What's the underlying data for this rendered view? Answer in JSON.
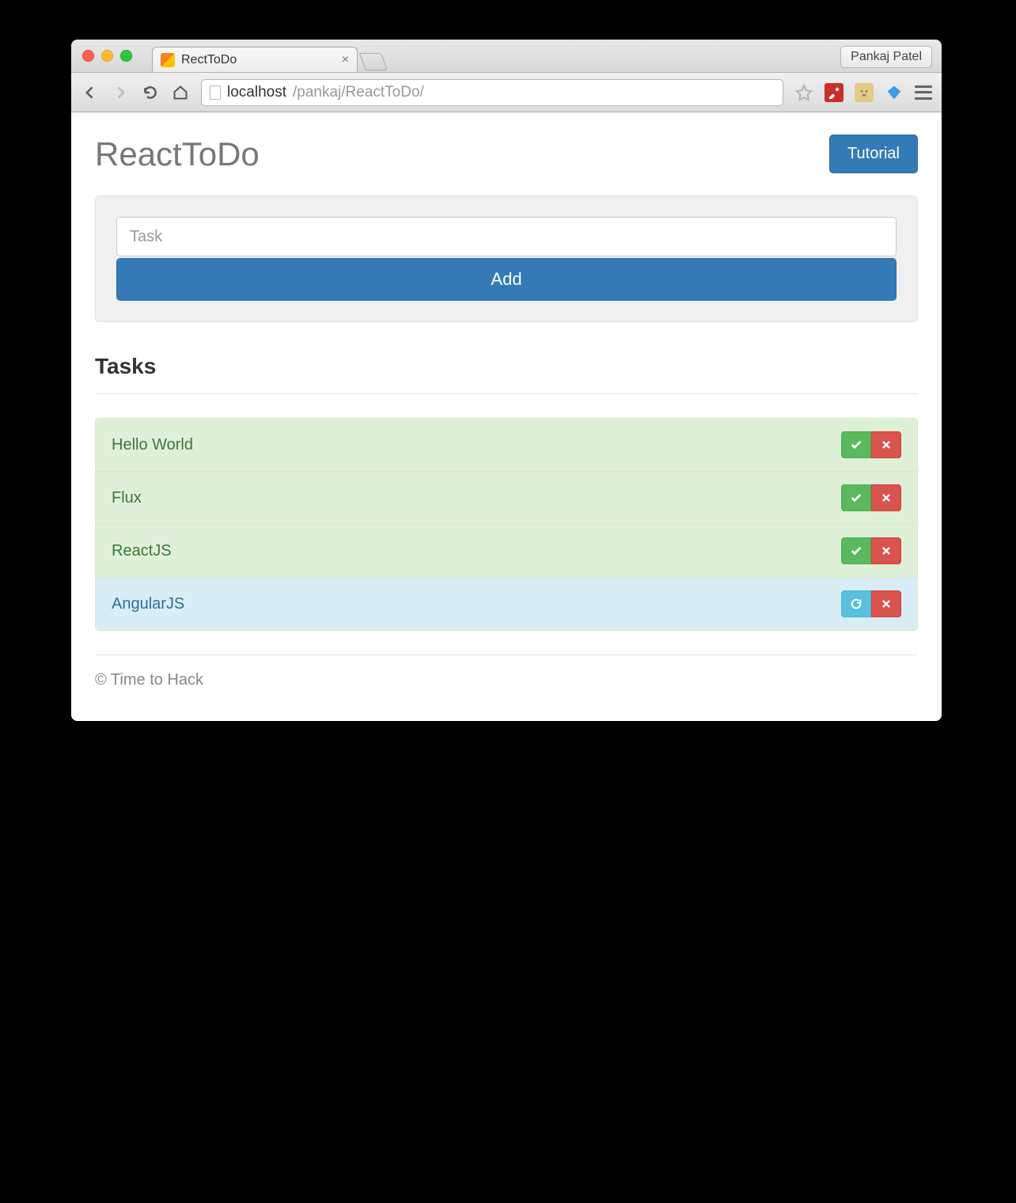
{
  "browser": {
    "tab_title": "RectToDo",
    "profile_name": "Pankaj Patel",
    "url_host": "localhost",
    "url_path": "/pankaj/ReactToDo/"
  },
  "header": {
    "app_title": "ReactToDo",
    "tutorial_label": "Tutorial"
  },
  "form": {
    "task_placeholder": "Task",
    "add_label": "Add"
  },
  "section": {
    "tasks_title": "Tasks"
  },
  "tasks": [
    {
      "label": "Hello World",
      "status": "success",
      "primary_action": "check"
    },
    {
      "label": "Flux",
      "status": "success",
      "primary_action": "check"
    },
    {
      "label": "ReactJS",
      "status": "success",
      "primary_action": "check"
    },
    {
      "label": "AngularJS",
      "status": "info",
      "primary_action": "refresh"
    }
  ],
  "footer": {
    "text": "© Time to Hack"
  },
  "colors": {
    "primary": "#337ab7",
    "success_bg": "#dff0d8",
    "info_bg": "#d9edf7",
    "danger": "#d9534f"
  }
}
